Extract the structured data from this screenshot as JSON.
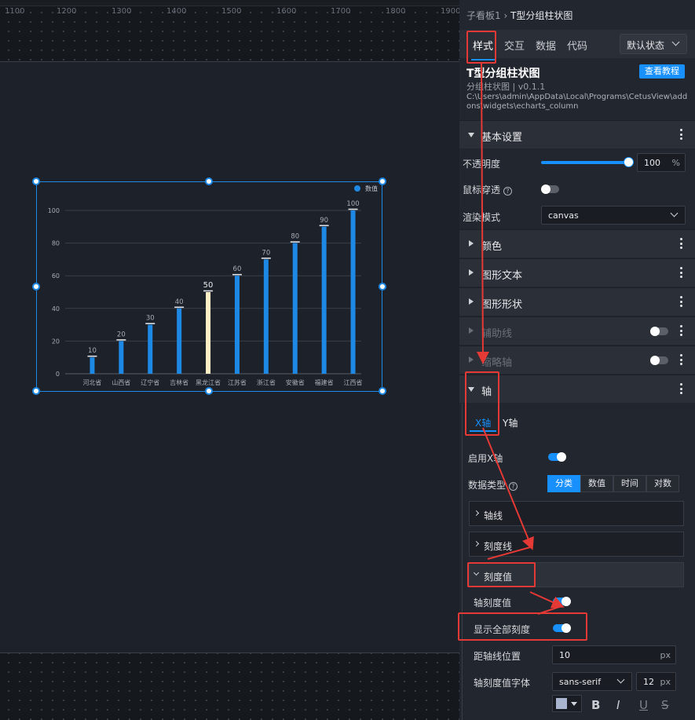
{
  "ruler": {
    "ticks": [
      "1100",
      "1200",
      "1300",
      "1400",
      "1500",
      "1600",
      "1700",
      "1800",
      "1900"
    ]
  },
  "chart_data": {
    "type": "bar",
    "title": "",
    "categories": [
      "河北省",
      "山西省",
      "辽宁省",
      "吉林省",
      "黑龙江省",
      "江苏省",
      "浙江省",
      "安徽省",
      "福建省",
      "江西省"
    ],
    "series": [
      {
        "name": "数值",
        "values": [
          10,
          20,
          30,
          40,
          50,
          60,
          70,
          80,
          90,
          100
        ]
      }
    ],
    "ylim": [
      0,
      100
    ],
    "yticks": [
      "0",
      "20",
      "40",
      "60",
      "80",
      "100"
    ],
    "highlight_index": 4,
    "bar_color": "#1e88e5",
    "highlight_color": "#fff1c6",
    "grid": true,
    "legend": "top-right"
  },
  "panel": {
    "breadcrumb_parent": "子看板1",
    "breadcrumb_sep": " › ",
    "breadcrumb_current": "T型分组柱状图",
    "tabs": [
      "样式",
      "交互",
      "数据",
      "代码"
    ],
    "state_label": "默认状态",
    "widget_title": "T型分组柱状图",
    "tutorial_label": "查看教程",
    "widget_sub": "分组柱状图 | v0.1.1",
    "widget_path": "C:\\Users\\admin\\AppData\\Local\\Programs\\CetusView\\addons\\widgets\\echarts_column",
    "sections": {
      "basic": "基本设置",
      "color": "颜色",
      "text": "图形文本",
      "shape": "图形形状",
      "aux": "辅助线",
      "thumb": "缩略轴",
      "axis": "轴"
    },
    "opacity_label": "不透明度",
    "opacity_value": "100",
    "percent": "%",
    "mouse_label": "鼠标穿透",
    "render_label": "渲染模式",
    "render_value": "canvas",
    "axis_tabs": [
      "X轴",
      "Y轴"
    ],
    "enable_x": "启用X轴",
    "data_type_label": "数据类型",
    "data_types": [
      "分类",
      "数值",
      "时间",
      "对数"
    ],
    "axis_line": "轴线",
    "tick_line": "刻度线",
    "tick_value": "刻度值",
    "axis_tick_value": "轴刻度值",
    "show_all": "显示全部刻度",
    "offset_label": "距轴线位置",
    "offset_value": "10",
    "px": "px",
    "font_label": "轴刻度值字体",
    "font_value": "sans-serif",
    "font_size": "12",
    "format_icons": [
      "B",
      "I",
      "U",
      "S"
    ]
  }
}
